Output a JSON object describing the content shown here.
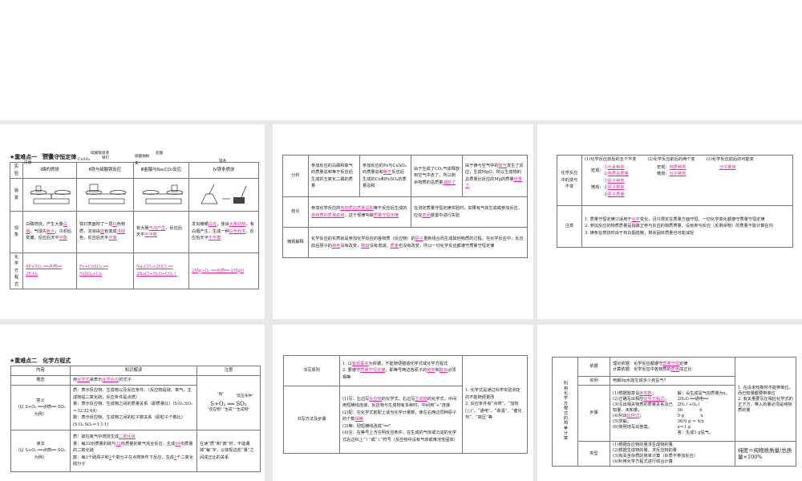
{
  "slide1": {
    "title": "★重难点一　质量守恒定律",
    "headers": [
      "实验",
      "Ⅰ磷的燃烧",
      "Ⅱ铁与硫酸铜反应",
      "Ⅲ盐酸与Na₂CO₃反应",
      "Ⅳ镁条燃烧"
    ],
    "row_labels": [
      "装置",
      "现象",
      "化学方程式"
    ],
    "apparatus_labels": [
      "白磷",
      "玻璃管",
      "硫酸铜溶液",
      "CuSO₄",
      "铁钉",
      "碳酸钠粉末",
      "盐酸",
      "镁条"
    ],
    "phenomena": [
      [
        {
          "t": "白磷燃烧，产生大量"
        },
        {
          "t": "白烟",
          "a": 1
        },
        {
          "t": "，气球先"
        },
        {
          "t": "胀大",
          "a": 1
        },
        {
          "t": "，冷却后变瘪，反应后天平"
        },
        {
          "t": "平衡",
          "a": 1
        }
      ],
      [
        {
          "t": "铁钉表面附了一层"
        },
        {
          "t": "红",
          "a": 1
        },
        {
          "t": "色物质，溶液由"
        },
        {
          "t": "蓝",
          "a": 1
        },
        {
          "t": "色变成"
        },
        {
          "t": "浅绿",
          "a": 1
        },
        {
          "t": "色，反应后天平"
        },
        {
          "t": "平衡",
          "a": 1
        }
      ],
      [
        {
          "t": "有大量"
        },
        {
          "t": "气泡产生",
          "a": 1
        },
        {
          "t": "，反应后天平"
        },
        {
          "t": "不平衡",
          "a": 1
        }
      ],
      [
        {
          "t": "发出耀眼"
        },
        {
          "t": "白光",
          "a": 1
        },
        {
          "t": "，放出"
        },
        {
          "t": "大量的热",
          "a": 1
        },
        {
          "t": "，有白烟产生，生成一种"
        },
        {
          "t": "白色粉末",
          "a": 1
        },
        {
          "t": "，反应后天平"
        },
        {
          "t": "不平衡",
          "a": 1
        }
      ]
    ],
    "equations": [
      [
        {
          "t": "4P+5O₂ ══点燃══ 2P₂O₅",
          "a": 1
        }
      ],
      [
        {
          "t": "Fe+CuSO₄ ══ FeSO₄+Cu",
          "a": 1
        }
      ],
      [
        {
          "t": "Na₂CO₃+2HCl ══ 2NaCl+H₂O+CO₂↑",
          "a": 1
        }
      ],
      [
        {
          "t": "2Mg+O₂ ══点燃══ 2MgO",
          "a": 1
        }
      ]
    ]
  },
  "slide2": {
    "row_labels": [
      "分析",
      "结论",
      "微观解释"
    ],
    "analysis": [
      [
        {
          "t": "参加反应的白磷和氧气的质量总和等于反应后生成的五氧化二磷的质量"
        }
      ],
      [
        {
          "t": "参加反应的Fe与CuSO₄的质量总和"
        },
        {
          "t": "等于",
          "a": 1
        },
        {
          "t": "反应后生成的Cu和FeSO₄的质量总和"
        }
      ],
      [
        {
          "t": "由于生成了CO₂气体释放到空气中去了，所以剩余物质的总质量"
        },
        {
          "t": "减轻了",
          "a": 1
        }
      ],
      [
        {
          "t": "由于镁与空气中的"
        },
        {
          "t": "氧气",
          "a": 1
        },
        {
          "t": "发生了反应，生成MgO，所以生成物的总质量比反应的Mg的质量"
        },
        {
          "t": "增重了",
          "a": 1
        }
      ]
    ],
    "conclusion": [
      [
        {
          "t": "参加化学反应的"
        },
        {
          "t": "各物质的质量总和",
          "a": 1
        },
        {
          "t": "等于反应后生成的"
        },
        {
          "t": "各物质的质量总和",
          "a": 1
        },
        {
          "t": "，这个规律叫做"
        },
        {
          "t": "质量守恒定律",
          "a": 1
        }
      ],
      [
        {
          "t": "在测定质量守恒定律实验时，如果有气体生成或参加反应，应在"
        },
        {
          "t": "密闭",
          "a": 1
        },
        {
          "t": "装置中进行实验"
        }
      ]
    ],
    "micro": [
      {
        "t": "化学反应的实质就是参加化学反应的各物质（反应物）的"
      },
      {
        "t": "原子",
        "a": 1
      },
      {
        "t": "重新组合而生成其他物质的过程。在化学反应中，反应前后原子的"
      },
      {
        "t": "种类",
        "a": 1
      },
      {
        "t": "没有改变，"
      },
      {
        "t": "数目",
        "a": 1
      },
      {
        "t": "没有增减，"
      },
      {
        "t": "质量",
        "a": 1
      },
      {
        "t": "也没有改变，所以一切化学反应都遵守质量守恒定律"
      }
    ]
  },
  "slide3": {
    "row_labels": [
      "化学反应中的变与不变",
      "注意"
    ],
    "five": "(1)化学反应前后的五个不变",
    "two": "(2)化学反应前后的两个变",
    "maybe": "(3)化学反应前后的可能变",
    "macro": "宏观：",
    "micro": "微观：",
    "five_macro": [
      [
        {
          "t": "①"
        },
        {
          "t": "元素种类",
          "a": 1
        }
      ],
      [
        {
          "t": "②"
        },
        {
          "t": "物质总质量",
          "a": 1
        }
      ]
    ],
    "five_micro": [
      [
        {
          "t": "①"
        },
        {
          "t": "原子种类",
          "a": 1
        }
      ],
      [
        {
          "t": "②"
        },
        {
          "t": "原子数目",
          "a": 1
        }
      ],
      [
        {
          "t": "③"
        },
        {
          "t": "原子质量",
          "a": 1
        }
      ]
    ],
    "two_macro": [
      {
        "t": "宏观："
      },
      {
        "t": "物质种类",
        "a": 1
      }
    ],
    "two_micro": [
      {
        "t": "微观："
      },
      {
        "t": "分子种类",
        "a": 1
      }
    ],
    "maybe_val": [
      {
        "t": "分子数目",
        "a": 1
      }
    ],
    "notes": [
      [
        {
          "t": "1. 质量守恒定律只适用于"
        },
        {
          "t": "化学",
          "a": 1
        },
        {
          "t": "变化，且只限定在质量方面守恒，一切化学变化都遵守质量守恒定律"
        }
      ],
      [
        {
          "t": "2. 参加反应的物质质量是指真正参与反应的物质质量，没有参与反应（反剩余物）的质量不能计算在内"
        }
      ],
      [
        {
          "t": "3. 镁条在燃烧时由于有白烟逸散，剩余固体质量也可能减轻"
        }
      ]
    ]
  },
  "slide4": {
    "title": "★重难点二　化学方程式",
    "headers": [
      "内容",
      "知识解读",
      "注意"
    ],
    "row_labels": [
      "概念",
      "意义",
      "读法"
    ],
    "example": "（以 S+O₂ ══点燃══ SO₂ 为例）",
    "concept": [
      {
        "t": "用"
      },
      {
        "t": "化学式",
        "a": 1
      },
      {
        "t": "来表示"
      },
      {
        "t": "化学反应",
        "a": 1
      },
      {
        "t": "的式子"
      }
    ],
    "meaning": [
      [
        {
          "t": "质：表示反应物、生成物以及反应条件。（反应物是硫、氧气，生成物是二氧化硫，反应条件是点燃）"
        }
      ],
      [
        {
          "t": "量：表示反应物、生成物之间的质量关系（即质量比）(S∶O₂∶SO₂＝32∶32∶64)"
        }
      ],
      [
        {
          "t": "数：表示反应物、生成物之间的粒子数关系（即粒子个数比）(S∶O₂∶SO₂＝1∶1∶1)"
        }
      ]
    ],
    "reading": [
      [
        {
          "t": "质：硫在氧气中燃烧生成"
        },
        {
          "t": "二氧化硫",
          "a": 1
        }
      ],
      [
        {
          "t": "量：每32份质量的硫与"
        },
        {
          "t": "32",
          "a": 1
        },
        {
          "t": "份质量的氧气完全反应，生成"
        },
        {
          "t": "64",
          "a": 1
        },
        {
          "t": "份质量的二氧化硫"
        }
      ],
      [
        {
          "t": "数：每1个硫原子和"
        },
        {
          "t": "1",
          "a": 1
        },
        {
          "t": "个氧分子在点燃条件下反应，生成"
        },
        {
          "t": "1",
          "a": 1
        },
        {
          "t": "个二氧化硫分子"
        }
      ]
    ],
    "diagram": {
      "eq": "S+O₂ ══ SO₂",
      "plus": "\"和\"",
      "cond": "\"反应条件\"",
      "lbl": "\"反应物\"  \"生成\"  \"生成物\""
    },
    "reading_note": "在读“质”和“数”时，不能漏掉“每”字，以体现这些“量”之间成正比的关系"
  },
  "slide5": {
    "row_labels": [
      "书写原则",
      "书写方法及步骤"
    ],
    "principles": [
      [
        {
          "t": "1. 以"
        },
        {
          "t": "客观事实",
          "a": 1
        },
        {
          "t": "为依据，不能随便臆造化学式或化学方程式"
        }
      ],
      [
        {
          "t": "2. 要遵守"
        },
        {
          "t": "质量守恒定律",
          "a": 1
        },
        {
          "t": "，即等号两边各原子的"
        },
        {
          "t": "种类",
          "a": 1
        },
        {
          "t": "和"
        },
        {
          "t": "数目",
          "a": 1
        },
        {
          "t": "必须相等"
        }
      ]
    ],
    "steps": [
      [
        {
          "t": "(1)写：左边写"
        },
        {
          "t": "反应物",
          "a": 1
        },
        {
          "t": "的化学式，右边写"
        },
        {
          "t": "生成物",
          "a": 1
        },
        {
          "t": "的化学式，中间用短横线连接，反应物与生成物有多种时，中间用“+”连接"
        }
      ],
      [
        {
          "t": "(2)配：在化学式前配上适当化学计量数，使左右两边同种原子的个数"
        },
        {
          "t": "相等",
          "a": 1
        }
      ],
      [
        {
          "t": "(3)等：把短横线改成“══”"
        }
      ],
      [
        {
          "t": "(4)注：在等号上方注明反应条件，在生成的气体或沉淀的化学式右边标上“↑”或“↓”符号（反应物中没有气体或难溶性固体）"
        }
      ]
    ],
    "notes": [
      [
        {
          "t": "1. 化学式是通过科学实验测定的不能随便更改"
        }
      ],
      [
        {
          "t": "2. 反应条件有“点燃”、“加热(△)”、“通电”、“高温”、“催化剂”、“高压”等"
        }
      ]
    ]
  },
  "slide6": {
    "side_label": "利用化学方程式的简单计算",
    "row_labels": [
      "依据",
      "实例",
      "步骤",
      "类型"
    ],
    "basis": [
      [
        {
          "t": "理论依据：化学反应都遵守"
        },
        {
          "t": "质量守恒",
          "a": 1
        },
        {
          "t": "定律"
        }
      ],
      [
        {
          "t": "计算依据：化学反应中各物质的"
        },
        {
          "t": "质量",
          "a": 1
        },
        {
          "t": "成正比"
        }
      ]
    ],
    "example": "电解9g水能生成多少克氢气？",
    "steps": [
      [
        {
          "t": "(1)根据题意设"
        },
        {
          "t": "未知数",
          "a": 1
        },
        {
          "t": "；"
        }
      ],
      [
        {
          "t": "(2)正确写出相应"
        },
        {
          "t": "化学方程式",
          "a": 1
        },
        {
          "t": "；"
        }
      ],
      [
        {
          "t": "(3)写出相关物质的质量关系及已知量、未知量；"
        }
      ],
      [
        {
          "t": "(4)列出"
        },
        {
          "t": "比例式",
          "a": 1
        },
        {
          "t": "；"
        }
      ],
      [
        {
          "t": "(5)求解；"
        }
      ],
      [
        {
          "t": "(6)简明地写出答案。"
        }
      ]
    ],
    "solution": [
      "解：设生成氢气的质量为x。",
      "2H₂O ══通电══ 2H₂↑+O₂↑",
      "36　　　　4",
      "9 g　　　　x",
      "36/9 g ＝ 4/x",
      "x＝1 g",
      "答：生成1 g氢气。"
    ],
    "types": [
      "(1)根据反应物的量求生成物的量",
      "(2)根据生成物的量，求反应物的量",
      "(3)有关含杂质的简单计算（杂质不参加反应）",
      "(4)利用化学方程式进行综合计算"
    ],
    "notes": [
      [
        {
          "t": "1. 在设未知数时不能带单位，而已知量都要带单位"
        }
      ],
      [
        {
          "t": "2. 有关量要写在相应化学式的正下方，带入的量必须是纯物质的量"
        }
      ]
    ],
    "purity": "纯度＝纯物质质量/总质量×100%"
  },
  "colors": {
    "answer": "#d4309a",
    "background": "#e8e8e8"
  }
}
